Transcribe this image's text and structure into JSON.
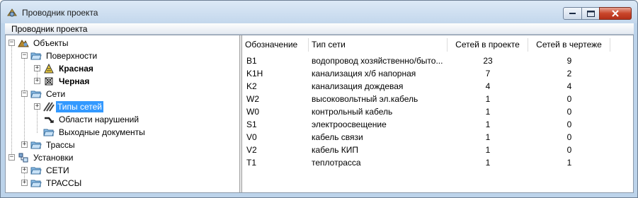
{
  "window": {
    "title": "Проводник проекта"
  },
  "menu": {
    "items": [
      "Проводник проекта"
    ]
  },
  "tree": {
    "root": "Объекты",
    "surfaces": {
      "label": "Поверхности",
      "children": [
        "Красная",
        "Черная"
      ]
    },
    "networks": {
      "label": "Сети",
      "children": [
        "Типы сетей",
        "Области нарушений",
        "Выходные документы"
      ]
    },
    "routes": "Трассы",
    "settings": {
      "label": "Установки",
      "children": [
        "СЕТИ",
        "ТРАССЫ"
      ]
    }
  },
  "table": {
    "columns": [
      "Обозначение",
      "Тип сети",
      "Сетей в проекте",
      "Сетей в чертеже"
    ],
    "rows": [
      [
        "B1",
        "водопровод хозяйственно/быто...",
        "23",
        "9"
      ],
      [
        "K1H",
        "канализация х/б напорная",
        "7",
        "2"
      ],
      [
        "K2",
        "канализация дождевая",
        "4",
        "4"
      ],
      [
        "W2",
        "высоковольтный эл.кабель",
        "1",
        "0"
      ],
      [
        "W0",
        "контрольный кабель",
        "1",
        "0"
      ],
      [
        "S1",
        "электроосвещение",
        "1",
        "0"
      ],
      [
        "V0",
        "кабель связи",
        "1",
        "0"
      ],
      [
        "V2",
        "кабель КИП",
        "1",
        "0"
      ],
      [
        "T1",
        "теплотрасса",
        "1",
        "1"
      ]
    ]
  },
  "colors": {
    "selection": "#3399ff",
    "titlebar": "#c3d7ec",
    "close_button": "#c9452a"
  }
}
